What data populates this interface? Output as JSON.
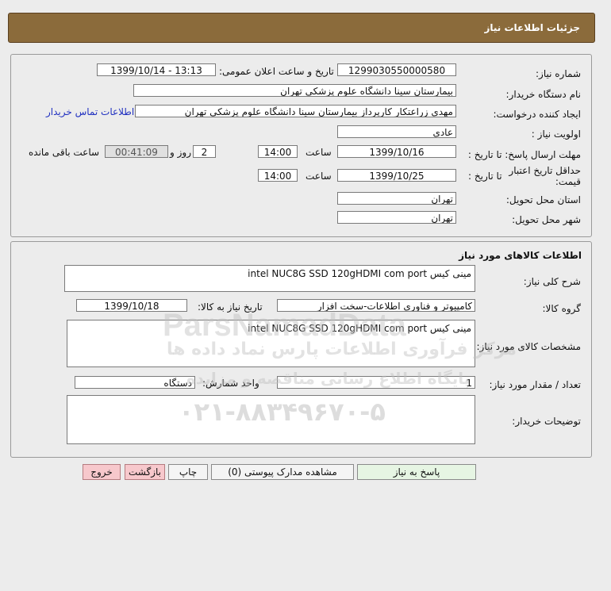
{
  "header": {
    "title": "جزئیات اطلاعات نیاز"
  },
  "info": {
    "need_number_label": "شماره نیاز:",
    "need_number": "1299030550000580",
    "announce_label": "تاریخ و ساعت اعلان عمومی:",
    "announce_value": "1399/10/14 - 13:13",
    "buyer_org_label": "نام دستگاه خریدار:",
    "buyer_org": "بیمارستان سینا دانشگاه علوم پزشکی تهران",
    "requester_label": "ایجاد کننده درخواست:",
    "requester": "مهدی  زراعتکار  کارپرداز بیمارستان سینا دانشگاه علوم پزشکی تهران",
    "contact_link": "اطلاعات تماس خریدار",
    "priority_label": "اولویت نیاز :",
    "priority": "عادی",
    "deadline_label": "مهلت ارسال پاسخ: تا تاریخ :",
    "deadline_date": "1399/10/16",
    "time_label": "ساعت",
    "deadline_time": "14:00",
    "days_count": "2",
    "days_label": "روز و",
    "remaining_time": "00:41:09",
    "remaining_label": "ساعت باقی مانده",
    "validity_label": "حداقل تاریخ اعتبار قیمت:",
    "validity_until": "تا تاریخ :",
    "validity_date": "1399/10/25",
    "validity_time": "14:00",
    "province_label": "استان محل تحویل:",
    "province": "تهران",
    "city_label": "شهر محل تحویل:",
    "city": "تهران"
  },
  "goods": {
    "title": "اطلاعات کالاهای مورد نیاز",
    "summary_label": "شرح کلی نیاز:",
    "summary": "مینی کیس intel NUC8G SSD 120gHDMI com port",
    "group_label": "گروه کالا:",
    "group": "کامپیوتر و فناوری اطلاعات-سخت افزار",
    "need_date_label": "تاریخ نیاز به کالا:",
    "need_date": "1399/10/18",
    "specs_label": "مشخصات کالای مورد نیاز:",
    "specs": "مینی کیس intel NUC8G SSD 120gHDMI com port",
    "qty_label": "تعداد / مقدار مورد نیاز:",
    "qty": "1",
    "unit_label": "واحد شمارش:",
    "unit": "دستگاه",
    "notes_label": "توضیحات خریدار:",
    "notes": ""
  },
  "buttons": {
    "respond": "پاسخ به نیاز",
    "attachments": "مشاهده مدارک پیوستی (0)",
    "print": "چاپ",
    "back": "بازگشت",
    "exit": "خروج"
  },
  "watermark": {
    "brand": "ParsNamadData",
    "line1": "مرکز فرآوری اطلاعات پارس نماد داده ها",
    "line2": "پایگاه اطلاع رسانی مناقصه و مزایده",
    "phone": "۰۲۱-۸۸۳۴۹۶۷۰-۵"
  }
}
